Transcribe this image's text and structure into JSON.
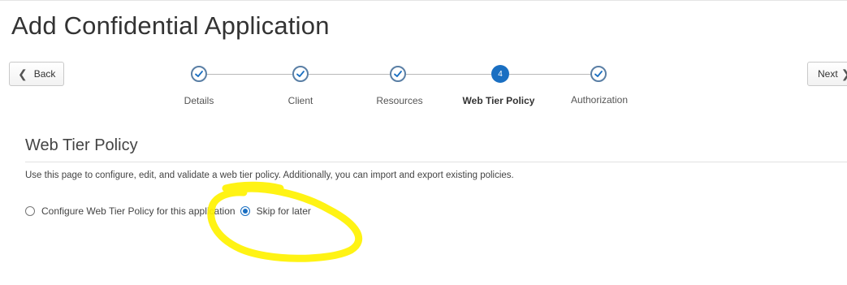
{
  "page": {
    "title": "Add Confidential Application"
  },
  "nav": {
    "back_label": "Back",
    "next_label": "Next"
  },
  "train": {
    "steps": [
      {
        "label": "Details",
        "state": "complete"
      },
      {
        "label": "Client",
        "state": "complete"
      },
      {
        "label": "Resources",
        "state": "complete"
      },
      {
        "label": "Web Tier Policy",
        "state": "current",
        "number": "4"
      },
      {
        "label": "Authorization",
        "state": "complete"
      }
    ]
  },
  "section": {
    "title": "Web Tier Policy",
    "description": "Use this page to configure, edit, and validate a web tier policy. Additionally, you can import and export existing policies."
  },
  "options": {
    "configure_label": "Configure Web Tier Policy for this application",
    "configure_selected": false,
    "skip_label": "Skip for later",
    "skip_selected": true
  },
  "colors": {
    "accent": "#1a6fc2",
    "step_complete": "#5a7fa5",
    "highlight": "#fff200"
  },
  "icons": {
    "back": "chevron-left-icon",
    "next": "chevron-right-icon",
    "step_complete": "check-circle-icon"
  }
}
